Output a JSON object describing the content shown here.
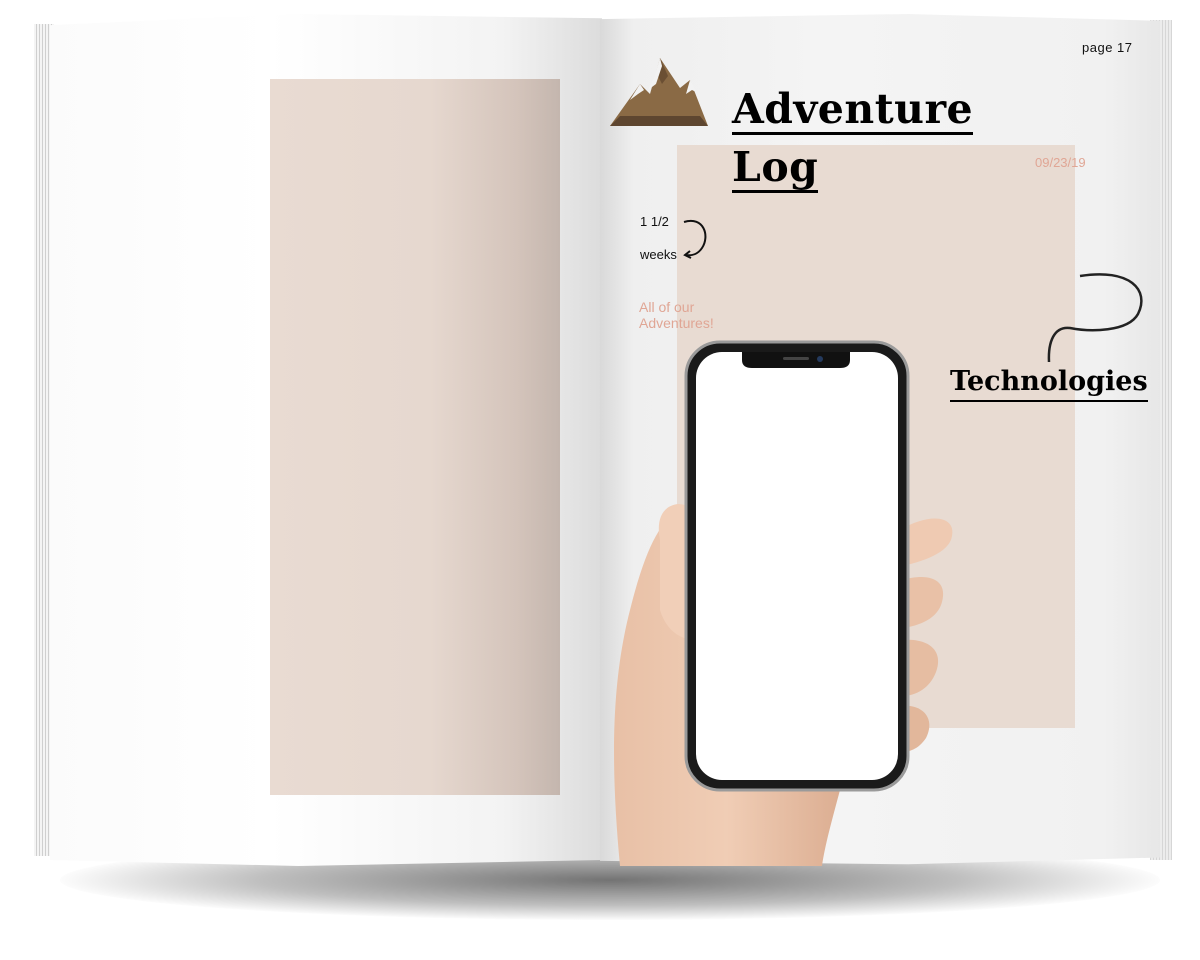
{
  "page_number": "page 17",
  "title": {
    "line1": "Adventure",
    "line2": "Log"
  },
  "date": "09/23/19",
  "duration": {
    "amount": "1 1/2",
    "unit": "weeks"
  },
  "caption": "All of our Adventures!",
  "section_heading": "Technologies",
  "colors": {
    "accent": "#e0a695",
    "block": "#e8dbd2",
    "ink": "#000000"
  }
}
